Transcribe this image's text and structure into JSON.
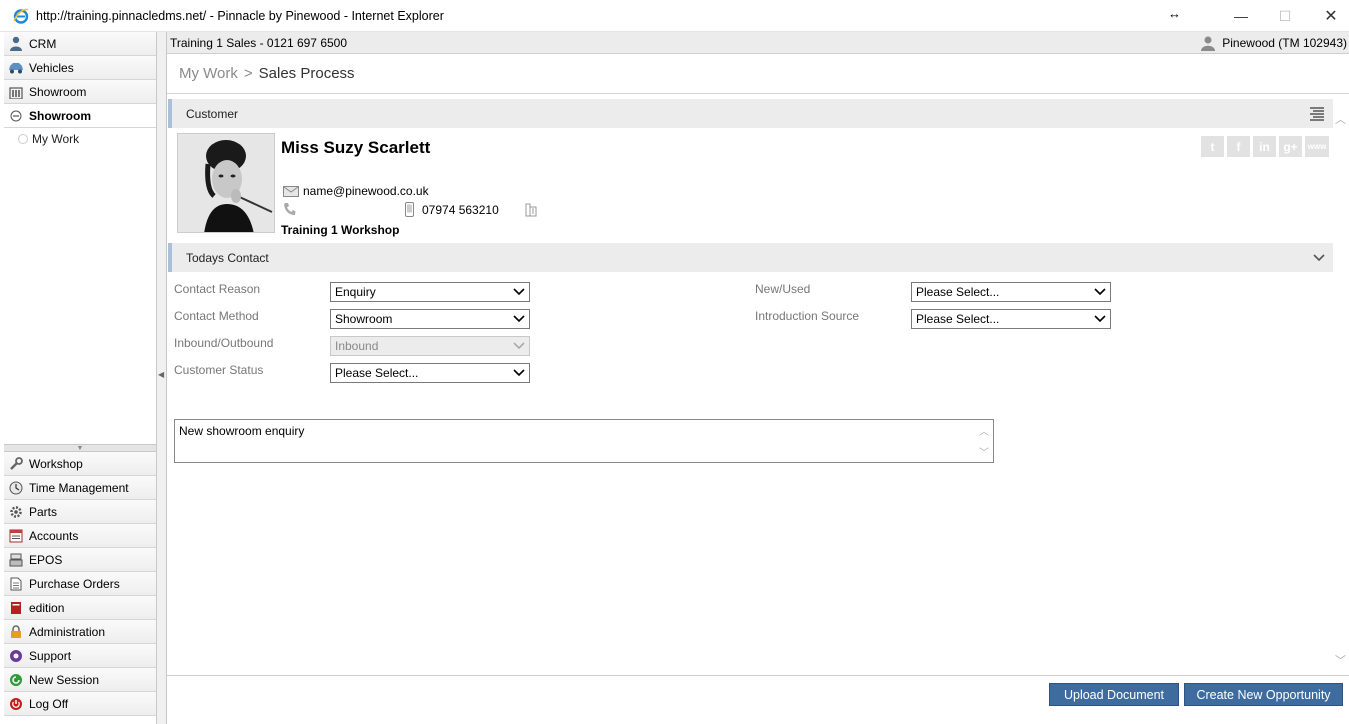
{
  "window": {
    "title": "http://training.pinnacledms.net/ - Pinnacle by Pinewood - Internet Explorer",
    "min_glyph": "—",
    "max_glyph": "☐",
    "close_glyph": "✕",
    "resize_glyph": "↔"
  },
  "sidebar": {
    "top_items": [
      {
        "label": "CRM",
        "icon": "person-icon"
      },
      {
        "label": "Vehicles",
        "icon": "car-icon"
      },
      {
        "label": "Showroom",
        "icon": "building-icon"
      }
    ],
    "active_item": {
      "label": "Showroom",
      "icon": "minus-circle-icon"
    },
    "sub_items": [
      {
        "label": "My Work"
      }
    ],
    "bottom_items": [
      {
        "label": "Workshop",
        "icon": "wrench-icon"
      },
      {
        "label": "Time Management",
        "icon": "clock-icon"
      },
      {
        "label": "Parts",
        "icon": "gear-icon"
      },
      {
        "label": "Accounts",
        "icon": "ledger-icon"
      },
      {
        "label": "EPOS",
        "icon": "till-icon"
      },
      {
        "label": "Purchase Orders",
        "icon": "document-icon"
      },
      {
        "label": "edition",
        "icon": "book-icon"
      },
      {
        "label": "Administration",
        "icon": "lock-icon"
      },
      {
        "label": "Support",
        "icon": "support-icon"
      },
      {
        "label": "New Session",
        "icon": "refresh-icon"
      },
      {
        "label": "Log Off",
        "icon": "power-icon"
      }
    ]
  },
  "topbar": {
    "location": "Training 1 Sales - 0121 697 6500",
    "user": "Pinewood (TM 102943)"
  },
  "breadcrumb": {
    "parent": "My Work",
    "separator": ">",
    "current": "Sales Process"
  },
  "customer": {
    "section_title": "Customer",
    "name": "Miss Suzy Scarlett",
    "email": "name@pinewood.co.uk",
    "mobile": "07974 563210",
    "branch": "Training 1 Workshop",
    "social": {
      "twitter": "t",
      "facebook": "f",
      "linkedin": "in",
      "googleplus": "g+",
      "www": "www"
    }
  },
  "contact": {
    "section_title": "Todays Contact",
    "fields": {
      "contact_reason": {
        "label": "Contact Reason",
        "value": "Enquiry"
      },
      "contact_method": {
        "label": "Contact Method",
        "value": "Showroom"
      },
      "inbound_outbound": {
        "label": "Inbound/Outbound",
        "value": "Inbound"
      },
      "customer_status": {
        "label": "Customer Status",
        "value": "Please Select..."
      },
      "new_used": {
        "label": "New/Used",
        "value": "Please Select..."
      },
      "introduction_source": {
        "label": "Introduction Source",
        "value": "Please Select..."
      }
    },
    "notes": "New showroom enquiry"
  },
  "footer": {
    "upload_label": "Upload Document",
    "create_label": "Create New Opportunity"
  },
  "colors": {
    "button_blue": "#3f6c9e",
    "section_accent": "#aac0d8"
  }
}
